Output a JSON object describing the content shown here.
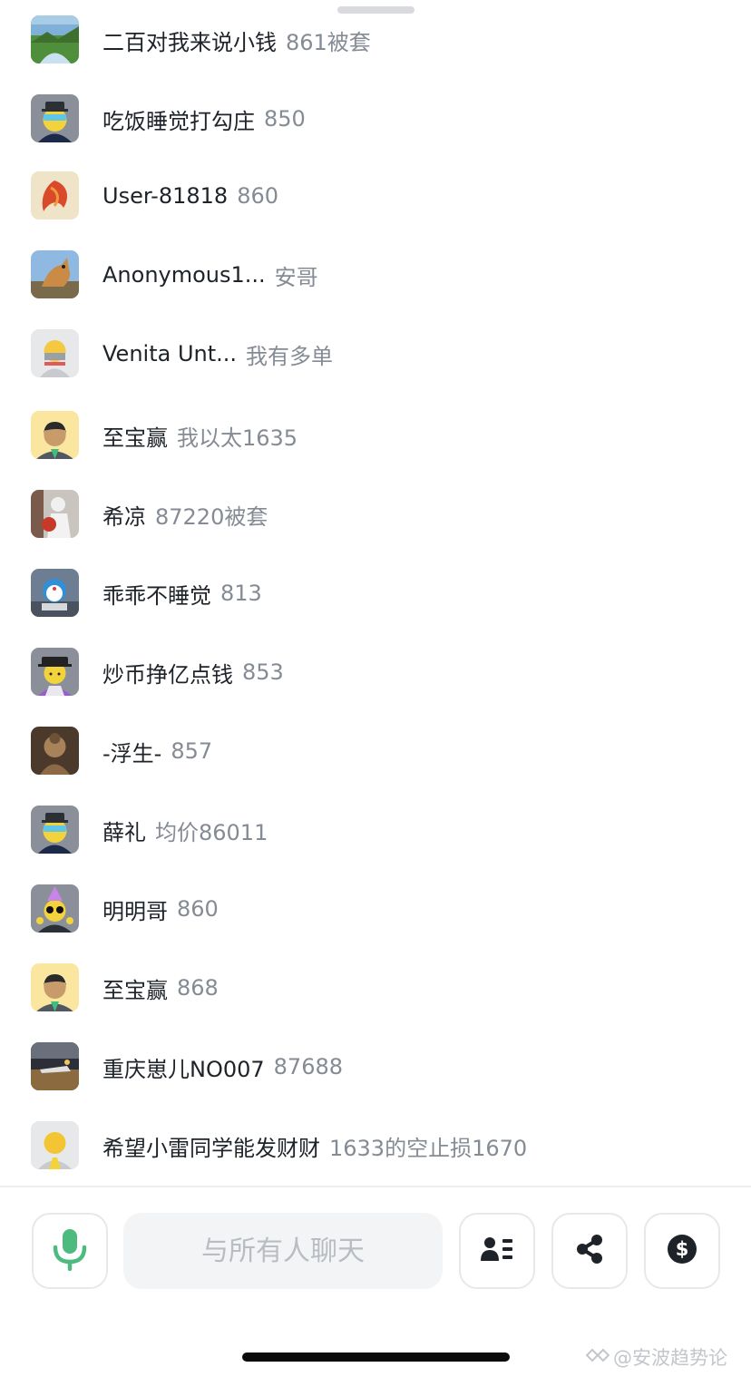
{
  "messages": [
    {
      "nickname": "二百对我来说小钱",
      "content": "861被套",
      "avatar": "landscape-avatar"
    },
    {
      "nickname": "吃饭睡觉打勾庄",
      "content": "850",
      "avatar": "cartoon-sunglasses-avatar"
    },
    {
      "nickname": "User-81818",
      "content": "860",
      "avatar": "phoenix-avatar"
    },
    {
      "nickname": "Anonymous1...",
      "content": "安哥",
      "avatar": "dog-photo-avatar"
    },
    {
      "nickname": "Venita Unt...",
      "content": "我有多单",
      "avatar": "default-gray-avatar"
    },
    {
      "nickname": "至宝赢",
      "content": "我以太1635",
      "avatar": "cartoon-girl-avatar"
    },
    {
      "nickname": "希凉",
      "content": "87220被套",
      "avatar": "flowers-photo-avatar"
    },
    {
      "nickname": "乖乖不睡觉",
      "content": "813",
      "avatar": "doraemon-avatar"
    },
    {
      "nickname": "炒币挣亿点钱",
      "content": "853",
      "avatar": "cartoon-hat-avatar"
    },
    {
      "nickname": "-浮生-",
      "content": "857",
      "avatar": "buddha-avatar"
    },
    {
      "nickname": "薛礼",
      "content": "均价86011",
      "avatar": "cartoon-sunglasses-avatar"
    },
    {
      "nickname": "明明哥",
      "content": "860",
      "avatar": "cartoon-party-avatar"
    },
    {
      "nickname": "至宝赢",
      "content": "868",
      "avatar": "cartoon-girl-avatar"
    },
    {
      "nickname": "重庆崽儿NO007",
      "content": "87688",
      "avatar": "airport-photo-avatar"
    },
    {
      "nickname": "希望小雷同学能发财财",
      "content": "1633的空止损1670",
      "avatar": "default-yellow-avatar"
    }
  ],
  "toolbar": {
    "chat_placeholder": "与所有人聊天",
    "mic_icon": "microphone-icon",
    "participants_icon": "participants-list-icon",
    "share_icon": "share-icon",
    "tip_icon": "dollar-tip-icon",
    "mic_color": "#4dbb7f"
  },
  "watermark": {
    "text": "@安波趋势论"
  }
}
